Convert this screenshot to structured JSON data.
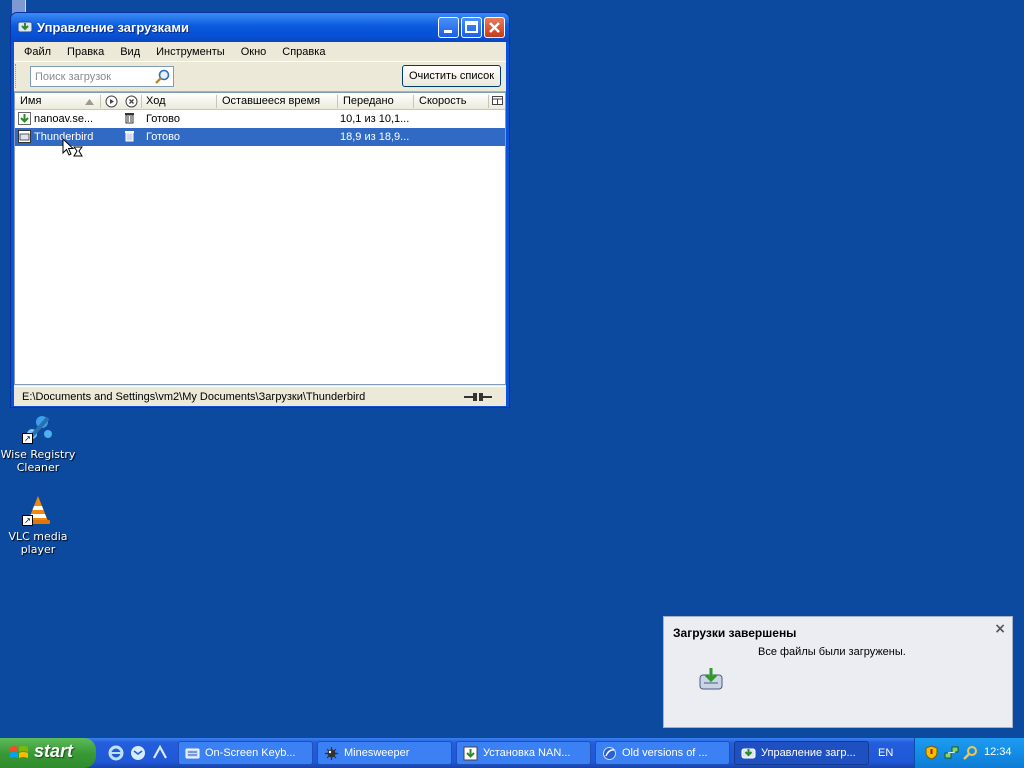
{
  "window": {
    "title": "Управление загрузками",
    "menu": [
      "Файл",
      "Правка",
      "Вид",
      "Инструменты",
      "Окно",
      "Справка"
    ],
    "search_placeholder": "Поиск загрузок",
    "clear_button": "Очистить список",
    "columns": [
      "Имя",
      "Ход",
      "Оставшееся время",
      "Передано",
      "Скорость"
    ],
    "rows": [
      {
        "name": "nanoav.se...",
        "status": "Готово",
        "transferred": "10,1 из 10,1...",
        "selected": false
      },
      {
        "name": "Thunderbird",
        "status": "Готово",
        "transferred": "18,9 из 18,9...",
        "selected": true
      }
    ],
    "status_path": "E:\\Documents and Settings\\vm2\\My Documents\\Загрузки\\Thunderbird"
  },
  "desktop_icons": [
    {
      "label_line1": "Wise Registry",
      "label_line2": "Cleaner"
    },
    {
      "label_line1": "VLC media",
      "label_line2": "player"
    }
  ],
  "notification": {
    "title": "Загрузки завершены",
    "body": "Все файлы были загружены."
  },
  "taskbar": {
    "start": "start",
    "buttons": [
      "On-Screen Keyb...",
      "Minesweeper",
      "Установка NAN...",
      "Old versions of ...",
      "Управление загр..."
    ],
    "language": "EN",
    "clock": "12:34"
  },
  "colors": {
    "desktop": "#0c4aa0",
    "titlebar": "#0a5ae0",
    "selection": "#316ac5",
    "start_green": "#3a9a37"
  }
}
